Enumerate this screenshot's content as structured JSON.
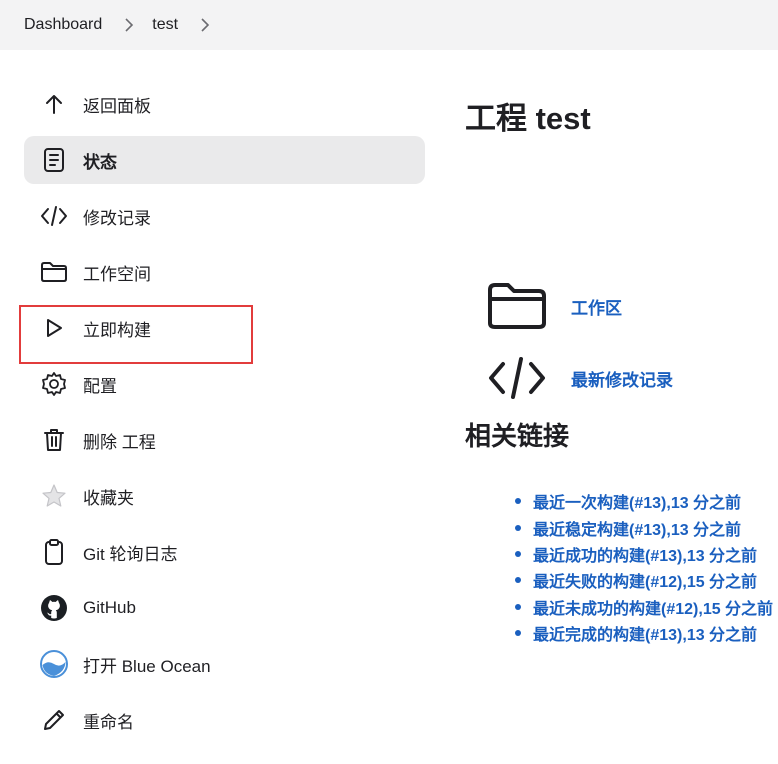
{
  "breadcrumb": {
    "items": [
      "Dashboard",
      "test"
    ]
  },
  "sidebar": {
    "items": [
      {
        "label": "返回面板",
        "icon": "arrow-up-icon"
      },
      {
        "label": "状态",
        "icon": "document-icon"
      },
      {
        "label": "修改记录",
        "icon": "code-icon"
      },
      {
        "label": "工作空间",
        "icon": "folder-icon"
      },
      {
        "label": "立即构建",
        "icon": "play-icon"
      },
      {
        "label": "配置",
        "icon": "gear-icon"
      },
      {
        "label": "删除 工程",
        "icon": "trash-icon"
      },
      {
        "label": "收藏夹",
        "icon": "star-icon"
      },
      {
        "label": "Git 轮询日志",
        "icon": "clipboard-icon"
      },
      {
        "label": "GitHub",
        "icon": "github-icon"
      },
      {
        "label": "打开 Blue Ocean",
        "icon": "blue-ocean-icon"
      },
      {
        "label": "重命名",
        "icon": "pencil-icon"
      }
    ]
  },
  "main": {
    "title": "工程 test",
    "workspace_link": "工作区",
    "changes_link": "最新修改记录",
    "permalinks_title": "相关链接",
    "permalinks": [
      {
        "text": "最近一次构建",
        "detail": "(#13),13 分之前"
      },
      {
        "text": "最近稳定构建",
        "detail": "(#13),13 分之前"
      },
      {
        "text": "最近成功的构建",
        "detail": "(#13),13 分之前"
      },
      {
        "text": "最近失败的构建",
        "detail": "(#12),15 分之前"
      },
      {
        "text": "最近未成功的构建",
        "detail": "(#12),15 分之前"
      },
      {
        "text": "最近完成的构建",
        "detail": "(#13),13 分之前"
      }
    ]
  },
  "colors": {
    "link": "#1a5fbf",
    "highlight_border": "#e23c3c",
    "active_bg": "#eaeaeb",
    "breadcrumb_bg": "#f3f3f4"
  }
}
